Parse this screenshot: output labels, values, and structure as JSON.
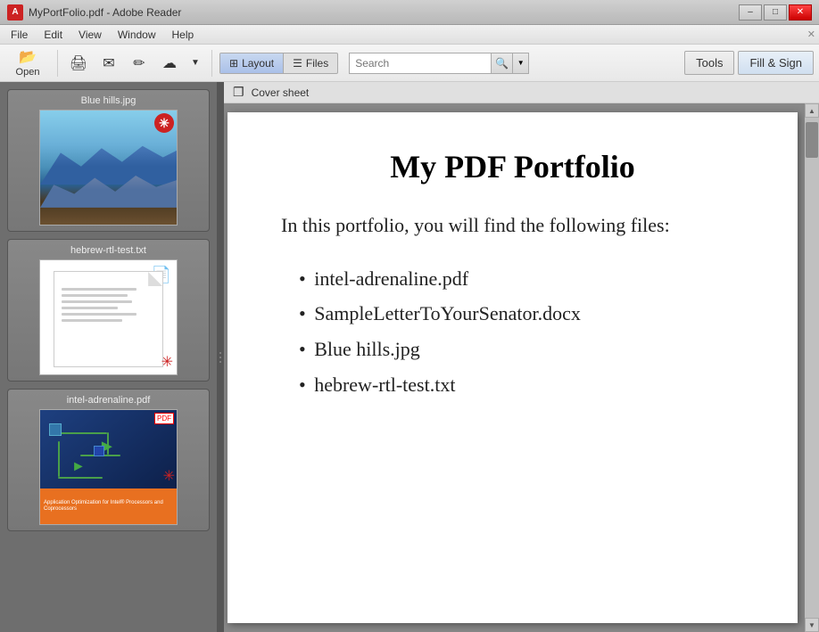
{
  "titlebar": {
    "title": "MyPortFolio.pdf - Adobe Reader",
    "icon_label": "A",
    "min_btn": "–",
    "restore_btn": "□",
    "close_btn": "✕"
  },
  "menubar": {
    "items": [
      "File",
      "Edit",
      "View",
      "Window",
      "Help"
    ]
  },
  "toolbar": {
    "open_label": "Open",
    "layout_label": "Layout",
    "files_label": "Files",
    "search_placeholder": "Search",
    "tools_label": "Tools",
    "fill_sign_label": "Fill & Sign"
  },
  "sidebar": {
    "items": [
      {
        "name": "Blue hills.jpg",
        "type": "image"
      },
      {
        "name": "hebrew-rtl-test.txt",
        "type": "text"
      },
      {
        "name": "intel-adrenaline.pdf",
        "type": "pdf"
      }
    ]
  },
  "breadcrumb": "Cover sheet",
  "pdf_content": {
    "title": "My PDF Portfolio",
    "intro": "In this portfolio, you will find the following files:",
    "files": [
      "intel-adrenaline.pdf",
      "SampleLetterToYourSenator.docx",
      "Blue hills.jpg",
      "hebrew-rtl-test.txt"
    ]
  },
  "icons": {
    "left_arrow": "◄",
    "right_arrow": "►",
    "up_arrow": "▲",
    "down_arrow": "▼",
    "search": "🔍",
    "dropdown": "▼",
    "copy": "❐"
  }
}
